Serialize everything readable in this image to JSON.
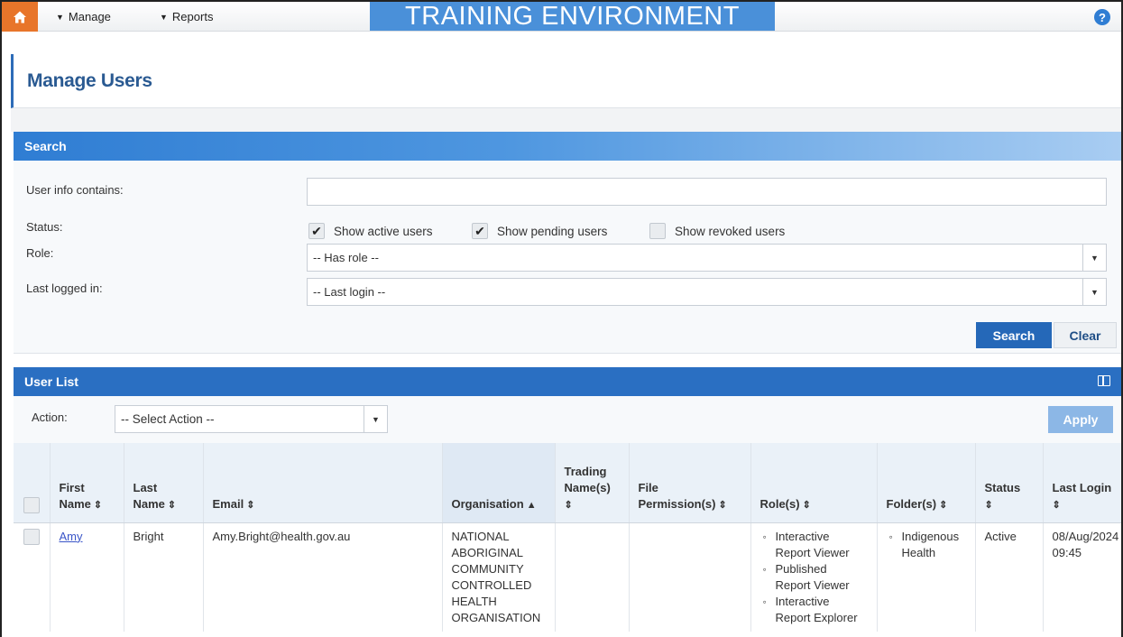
{
  "nav": {
    "manage": "Manage",
    "reports": "Reports",
    "banner": "TRAINING ENVIRONMENT",
    "help": "?"
  },
  "page": {
    "title": "Manage Users"
  },
  "search": {
    "header": "Search",
    "user_info_label": "User info contains:",
    "user_info_value": "",
    "status_label": "Status:",
    "checkboxes": [
      {
        "label": "Show active users",
        "checked": true
      },
      {
        "label": "Show pending users",
        "checked": true
      },
      {
        "label": "Show revoked users",
        "checked": false
      }
    ],
    "role_label": "Role:",
    "role_value": "-- Has role --",
    "last_login_label": "Last logged in:",
    "last_login_value": "-- Last login --",
    "search_button": "Search",
    "clear_button": "Clear"
  },
  "user_list": {
    "header": "User List",
    "action_label": "Action:",
    "action_value": "-- Select Action --",
    "apply_button": "Apply",
    "columns": {
      "first_name": [
        "First",
        "Name"
      ],
      "last_name": [
        "Last",
        "Name"
      ],
      "email": "Email",
      "organisation": "Organisation",
      "trading": [
        "Trading",
        "Name(s)"
      ],
      "file_perm": [
        "File",
        "Permission(s)"
      ],
      "roles": "Role(s)",
      "folders": "Folder(s)",
      "status": "Status",
      "last_login": "Last Login"
    },
    "rows": [
      {
        "first_name": "Amy",
        "last_name": "Bright",
        "email": "Amy.Bright@health.gov.au",
        "organisation": [
          "NATIONAL",
          "ABORIGINAL",
          "COMMUNITY",
          "CONTROLLED",
          "HEALTH",
          "ORGANISATION"
        ],
        "trading": "",
        "file_perm": "",
        "roles": [
          [
            "Interactive",
            "Report Viewer"
          ],
          [
            "Published",
            "Report Viewer"
          ],
          [
            "Interactive",
            "Report Explorer"
          ]
        ],
        "folders": [
          [
            "Indigenous",
            "Health"
          ]
        ],
        "status": "Active",
        "last_login": [
          "08/Aug/2024",
          "09:45"
        ]
      }
    ]
  },
  "colors": {
    "accent": "#2a6fc2",
    "home": "#e8752a",
    "banner": "#4a90d9",
    "title": "#2a5a92"
  }
}
